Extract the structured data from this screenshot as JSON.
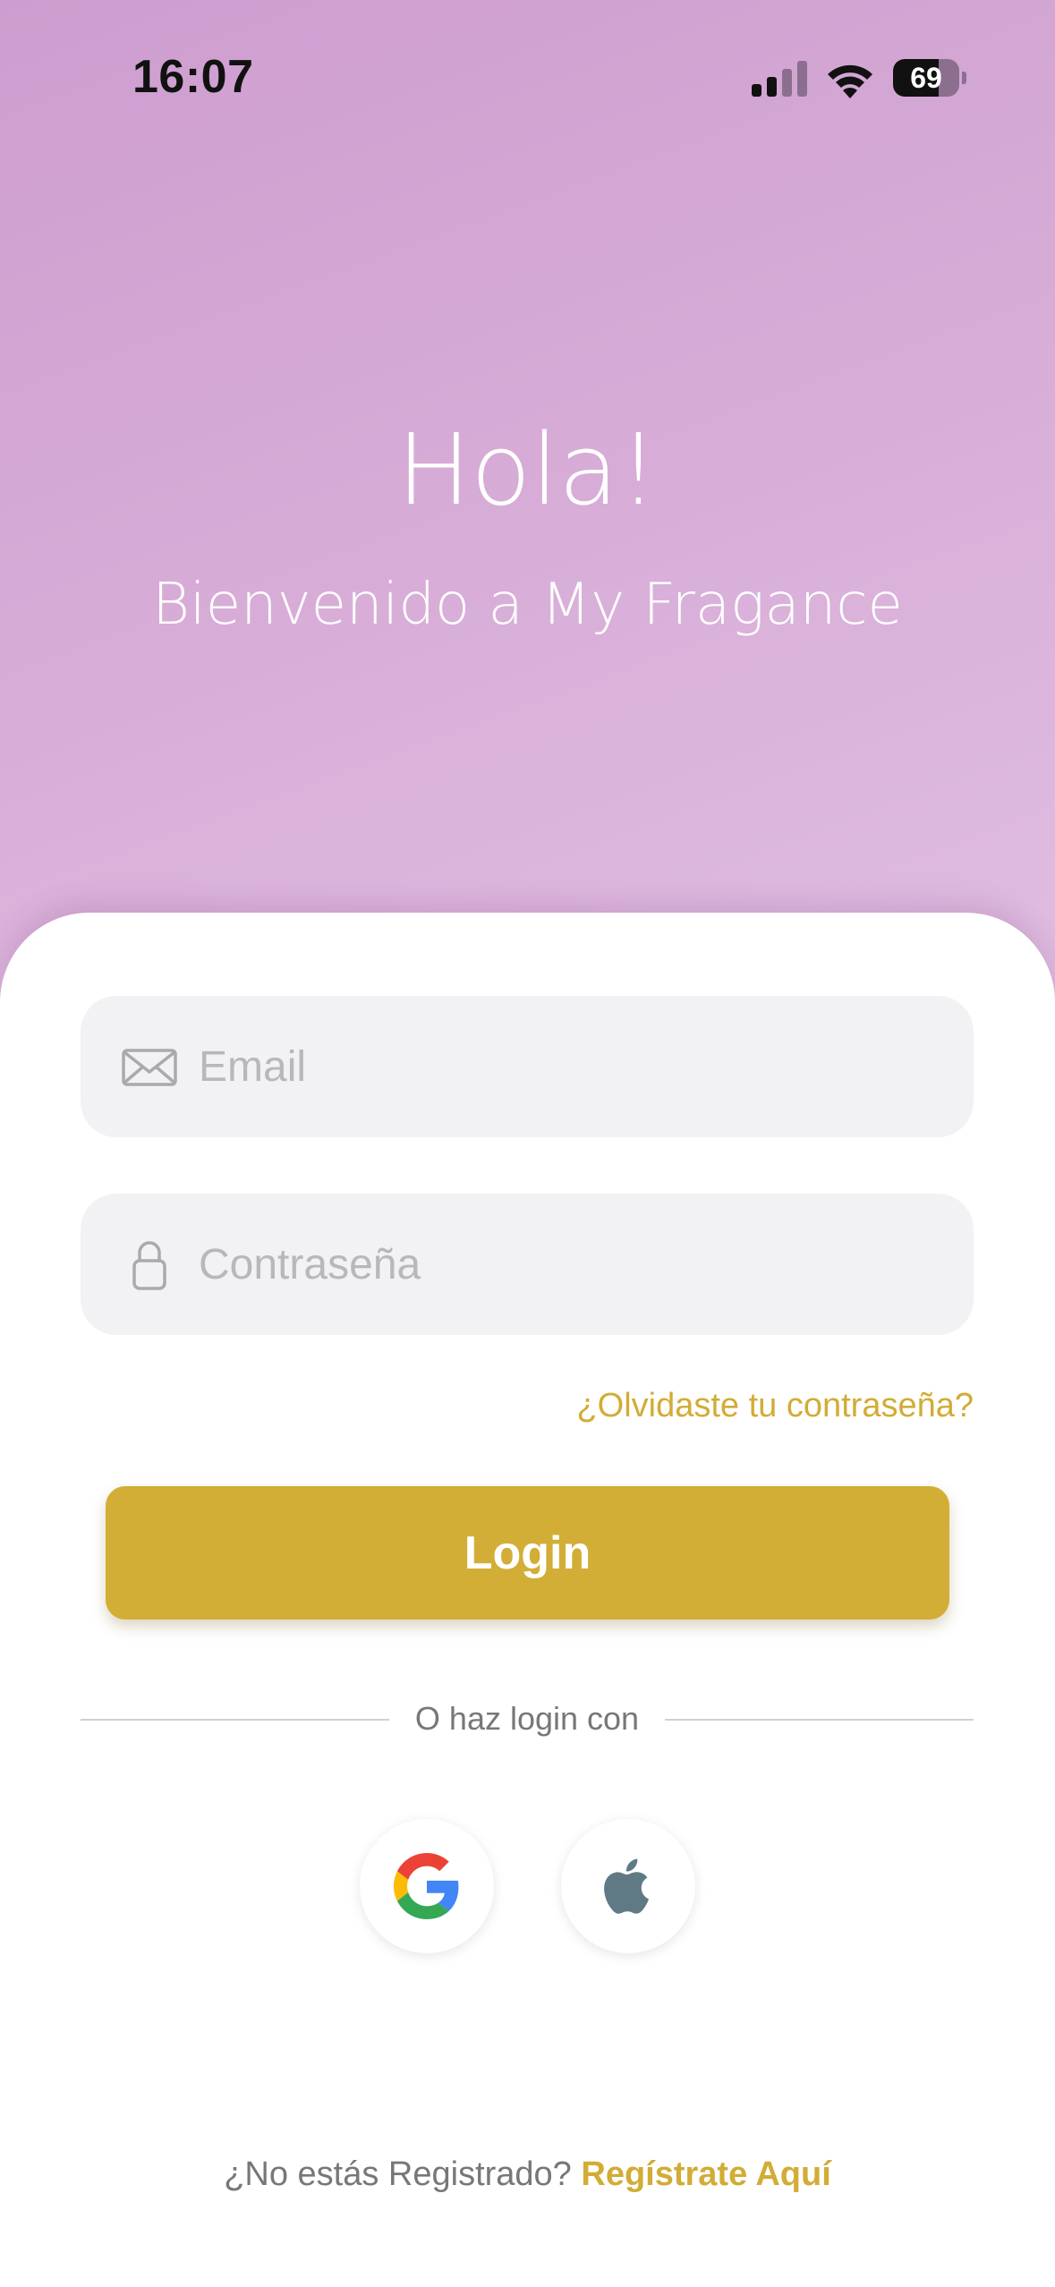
{
  "status_bar": {
    "time": "16:07",
    "battery_level": "69",
    "battery_fraction": 0.69,
    "signal_icon": "cellular-signal-icon",
    "wifi_icon": "wifi-icon",
    "battery_icon": "battery-icon"
  },
  "hero": {
    "title": "Hola!",
    "subtitle": "Bienvenido a My Fragance",
    "gradient_colors": [
      "#cd9dcf",
      "#e0bde1"
    ]
  },
  "form": {
    "email": {
      "placeholder": "Email",
      "value": "",
      "icon": "envelope-icon"
    },
    "password": {
      "placeholder": "Contraseña",
      "value": "",
      "icon": "lock-icon"
    },
    "forgot_password": "¿Olvidaste tu contraseña?",
    "login_label": "Login"
  },
  "social": {
    "divider_text": "O haz login con",
    "providers": [
      {
        "name": "Google",
        "icon": "google-icon"
      },
      {
        "name": "Apple",
        "icon": "apple-icon"
      }
    ]
  },
  "signup": {
    "prompt": "¿No estás Registrado?",
    "link": "Regístrate Aquí"
  },
  "colors": {
    "accent": "#d3ae36",
    "link": "#d2ac35",
    "field_bg": "#f2f2f4",
    "placeholder": "#b8b8bc",
    "muted_text": "#777777"
  }
}
